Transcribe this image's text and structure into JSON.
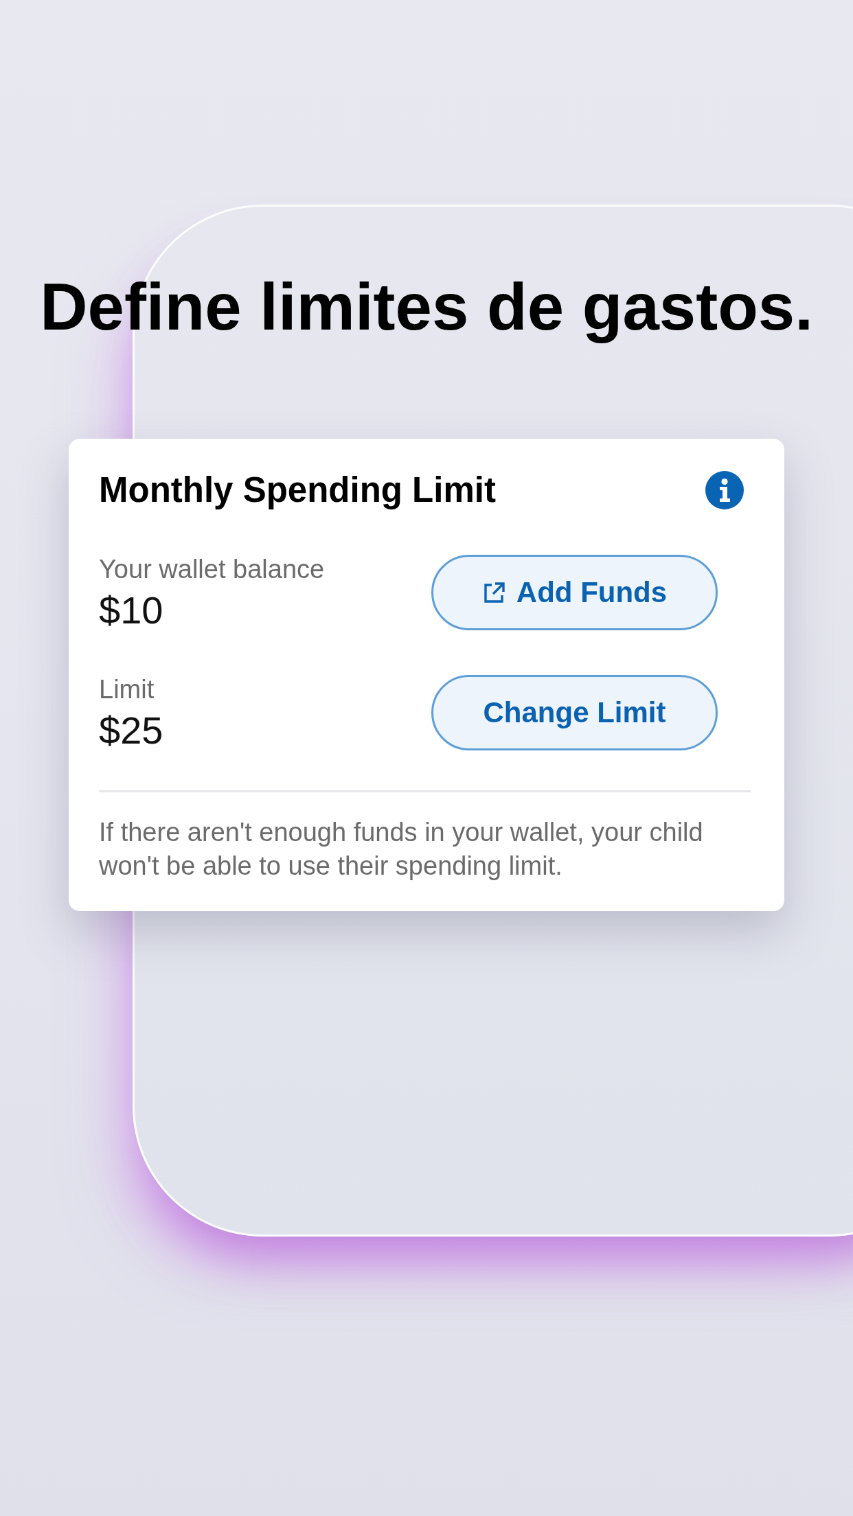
{
  "headline": "Define limites de gastos.",
  "card": {
    "title": "Monthly Spending Limit",
    "rows": [
      {
        "label": "Your wallet balance",
        "value": "$10",
        "button": {
          "label": "Add Funds",
          "kind": "external"
        }
      },
      {
        "label": "Limit",
        "value": "$25",
        "button": {
          "label": "Change Limit",
          "kind": "plain"
        }
      }
    ],
    "note": "If there aren't enough funds in your wallet, your child won't be able to use their spending limit."
  }
}
